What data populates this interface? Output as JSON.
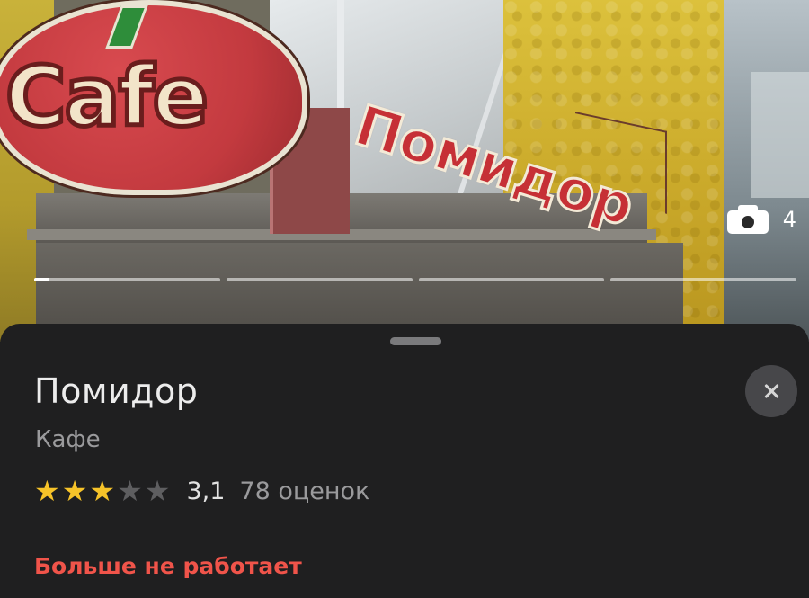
{
  "photo": {
    "count": "4",
    "progress_segments": 4,
    "active_segment_fill": 0.08
  },
  "place": {
    "name": "Помидор",
    "category": "Кафе",
    "rating_value": "3,1",
    "rating_count": "78 оценок",
    "stars_filled": 3,
    "stars_total": 5,
    "status": "Больше не работает"
  },
  "colors": {
    "sheet_bg": "#1f1f20",
    "star_on": "#f6c329",
    "star_off": "#5e5e60",
    "status_red": "#f0544a"
  },
  "icons": {
    "camera": "camera-icon",
    "close": "close-icon",
    "star": "star-icon"
  }
}
